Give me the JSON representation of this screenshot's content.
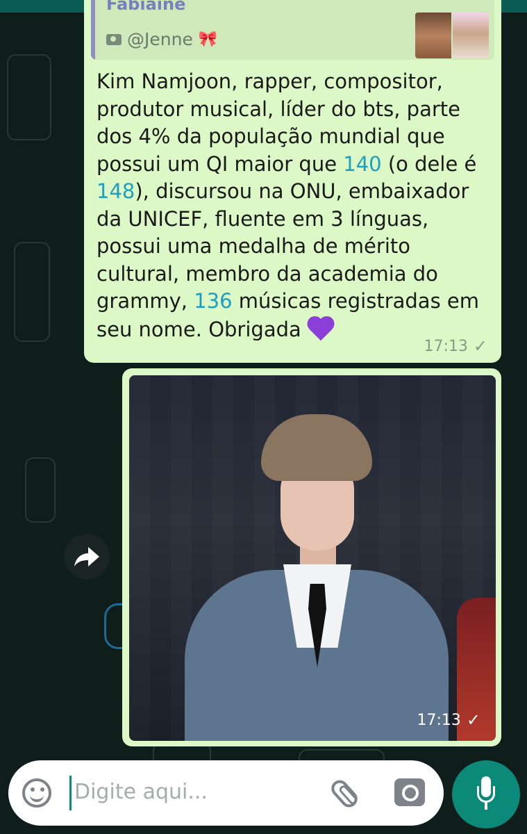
{
  "colors": {
    "accent": "#0b8a7a",
    "bubble": "#dcf8c6",
    "number_link": "#1f9fbf"
  },
  "quote": {
    "author": "Fabiaine",
    "caption": "@Jenne",
    "caption_icon": "camera-icon",
    "emoji": "🎀"
  },
  "message": {
    "parts": [
      "Kim Namjoon, rapper, compositor, produtor musical, líder do bts, parte dos 4% da população mundial que possui um QI maior que ",
      "140",
      " (o dele é ",
      "148",
      "), discursou na ONU, embaixador da UNICEF, fluente em 3 línguas, possui uma medalha de mérito cultural, membro da academia do grammy, ",
      "136",
      " músicas registradas em seu nome. Obrigada "
    ],
    "emoji_icon": "purple-heart-icon",
    "time": "17:13",
    "status_icon": "check-icon"
  },
  "image_message": {
    "time": "17:13",
    "status_icon": "check-icon"
  },
  "input": {
    "placeholder": "Digite aqui...",
    "emoji_icon": "emoji-icon",
    "attach_icon": "paperclip-icon",
    "camera_icon": "camera-icon",
    "send_icon": "mic-icon"
  }
}
